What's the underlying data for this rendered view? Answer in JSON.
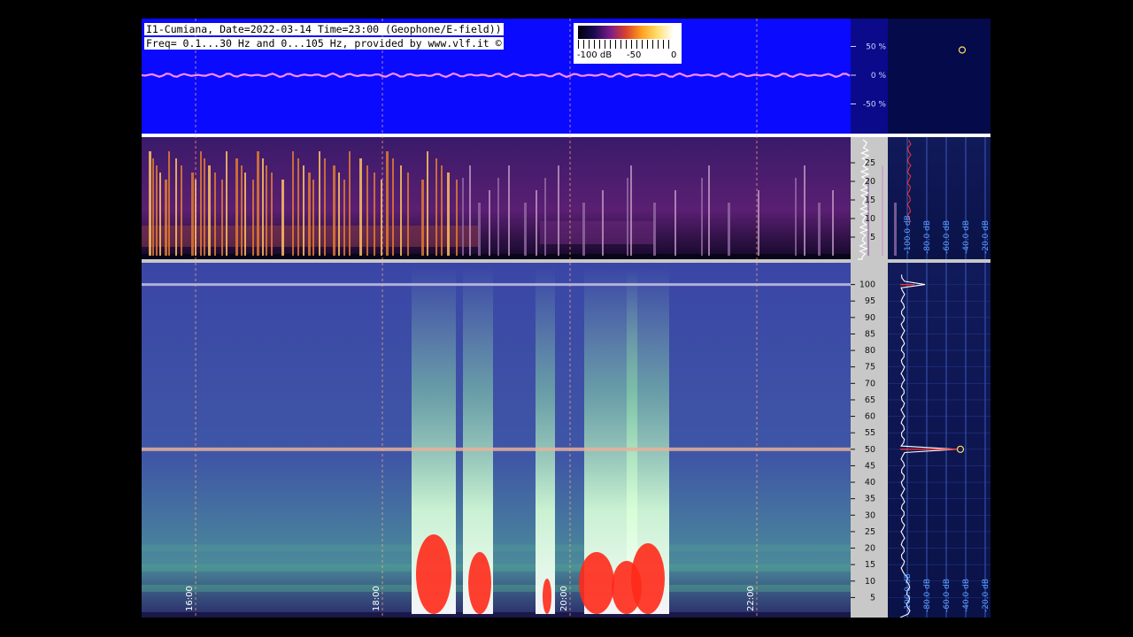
{
  "header": {
    "line1": "I1-Cumiana, Date=2022-03-14 Time=23:00 (Geophone/E-field))",
    "line2": "Freq= 0.1...30 Hz and 0...105 Hz, provided by www.vlf.it ©"
  },
  "colorbar": {
    "labels": [
      "-100 dB",
      "-50",
      "0"
    ]
  },
  "chart_data": [
    {
      "type": "line",
      "name": "amplitude-strip",
      "ylabels": [
        "50 %",
        "0 %",
        "-50 %"
      ],
      "yvalues": [
        50,
        0,
        -50
      ],
      "colors": {
        "background": "#0a0aff",
        "trace": "#ff88ff"
      }
    },
    {
      "type": "heatmap",
      "name": "spectrogram-0-30hz",
      "yticks": [
        5,
        10,
        15,
        20,
        25
      ],
      "ylim": [
        0,
        30
      ],
      "db_ticks": [
        "-100.0 dB",
        "-80.0 dB",
        "-60.0 dB",
        "-40.0 dB",
        "-20.0 dB"
      ]
    },
    {
      "type": "heatmap",
      "name": "spectrogram-0-105hz",
      "yticks": [
        5,
        10,
        15,
        20,
        25,
        30,
        35,
        40,
        45,
        50,
        55,
        60,
        65,
        70,
        75,
        80,
        85,
        90,
        95,
        100
      ],
      "ylim": [
        0,
        105
      ],
      "xticks": [
        "16:00",
        "18:00",
        "20:00",
        "22:00"
      ],
      "db_ticks": [
        "-100.0 dB",
        "-80.0 dB",
        "-60.0 dB",
        "-40.0 dB",
        "-20.0 dB"
      ],
      "colors": {
        "background": "#3a4aa8",
        "low": "#4caa88",
        "mid": "#c8f0c0",
        "high": "#ff2a1a"
      }
    }
  ]
}
